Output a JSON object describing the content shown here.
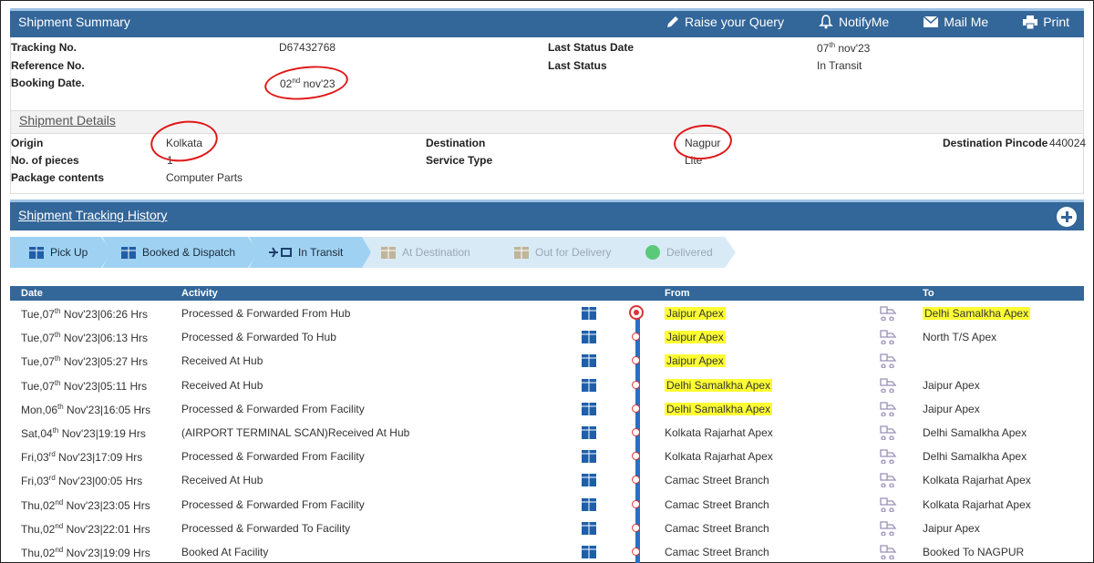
{
  "summary": {
    "title": "Shipment Summary",
    "actions": {
      "raise_query": "Raise your Query",
      "notify": "NotifyMe",
      "mail": "Mail Me",
      "print": "Print"
    },
    "tracking_label": "Tracking No.",
    "tracking_value": "D67432768",
    "reference_label": "Reference No.",
    "booking_label": "Booking Date.",
    "booking_day": "02",
    "booking_sup": "nd",
    "booking_rest": " nov'23",
    "last_status_date_label": "Last Status Date",
    "last_status_date_day": "07",
    "last_status_date_sup": "th",
    "last_status_date_rest": " nov'23",
    "last_status_label": "Last Status",
    "last_status_value": "In Transit"
  },
  "details": {
    "title": "Shipment Details",
    "origin_label": "Origin",
    "origin_value": "Kolkata",
    "pieces_label": "No. of pieces",
    "pieces_value": "1",
    "contents_label": "Package contents",
    "contents_value": "Computer Parts",
    "destination_label": "Destination",
    "destination_value": "Nagpur",
    "service_label": "Service Type",
    "service_value": "Lite",
    "pincode_label": "Destination Pincode",
    "pincode_value": "440024"
  },
  "history": {
    "title": "Shipment Tracking History",
    "steps": [
      {
        "label": "Pick Up",
        "state": "done"
      },
      {
        "label": "Booked & Dispatch",
        "state": "done"
      },
      {
        "label": "In Transit",
        "state": "current"
      },
      {
        "label": "At Destination",
        "state": "pending"
      },
      {
        "label": "Out for Delivery",
        "state": "pending"
      },
      {
        "label": "Delivered",
        "state": "pending"
      }
    ],
    "columns": {
      "date": "Date",
      "activity": "Activity",
      "from": "From",
      "to": "To"
    },
    "rows": [
      {
        "day": "Tue,07",
        "sup": "th",
        "rest": " Nov'23|06:26 Hrs",
        "activity": "Processed & Forwarded From Hub",
        "from": "Jaipur Apex",
        "to": "Delhi Samalkha Apex",
        "hl_from": true,
        "hl_to": true
      },
      {
        "day": "Tue,07",
        "sup": "th",
        "rest": " Nov'23|06:13 Hrs",
        "activity": "Processed & Forwarded To Hub",
        "from": "Jaipur Apex",
        "to": "North T/S Apex",
        "hl_from": true,
        "hl_to": false
      },
      {
        "day": "Tue,07",
        "sup": "th",
        "rest": " Nov'23|05:27 Hrs",
        "activity": "Received At Hub",
        "from": "Jaipur Apex",
        "to": "",
        "hl_from": true,
        "hl_to": false
      },
      {
        "day": "Tue,07",
        "sup": "th",
        "rest": " Nov'23|05:11 Hrs",
        "activity": "Received At Hub",
        "from": "Delhi Samalkha Apex",
        "to": "Jaipur Apex",
        "hl_from": true,
        "hl_to": false
      },
      {
        "day": "Mon,06",
        "sup": "th",
        "rest": " Nov'23|16:05 Hrs",
        "activity": "Processed & Forwarded From Facility",
        "from": "Delhi Samalkha Apex",
        "to": "Jaipur Apex",
        "hl_from": true,
        "hl_to": false
      },
      {
        "day": "Sat,04",
        "sup": "th",
        "rest": " Nov'23|19:19 Hrs",
        "activity": "(AIRPORT TERMINAL SCAN)Received At Hub",
        "from": "Kolkata Rajarhat Apex",
        "to": "Delhi Samalkha Apex",
        "hl_from": false,
        "hl_to": false
      },
      {
        "day": "Fri,03",
        "sup": "rd",
        "rest": " Nov'23|17:09 Hrs",
        "activity": "Processed & Forwarded From Facility",
        "from": "Kolkata Rajarhat Apex",
        "to": "Delhi Samalkha Apex",
        "hl_from": false,
        "hl_to": false
      },
      {
        "day": "Fri,03",
        "sup": "rd",
        "rest": " Nov'23|00:05 Hrs",
        "activity": "Received At Hub",
        "from": "Camac Street Branch",
        "to": "Kolkata Rajarhat Apex",
        "hl_from": false,
        "hl_to": false
      },
      {
        "day": "Thu,02",
        "sup": "nd",
        "rest": " Nov'23|23:05 Hrs",
        "activity": "Processed & Forwarded From Facility",
        "from": "Camac Street Branch",
        "to": "Kolkata Rajarhat Apex",
        "hl_from": false,
        "hl_to": false
      },
      {
        "day": "Thu,02",
        "sup": "nd",
        "rest": " Nov'23|22:01 Hrs",
        "activity": "Processed & Forwarded To Facility",
        "from": "Camac Street Branch",
        "to": "Jaipur Apex",
        "hl_from": false,
        "hl_to": false
      },
      {
        "day": "Thu,02",
        "sup": "nd",
        "rest": " Nov'23|19:09 Hrs",
        "activity": "Booked At Facility",
        "from": "Camac Street Branch",
        "to": "Booked To NAGPUR",
        "hl_from": false,
        "hl_to": false
      }
    ]
  },
  "colors": {
    "header": "#336699",
    "step_done": "#9fd2f2",
    "step_pending": "#d8eaf6",
    "timeline": "#2a6fc1",
    "highlight": "#ffff33",
    "annotation": "#e01818"
  }
}
